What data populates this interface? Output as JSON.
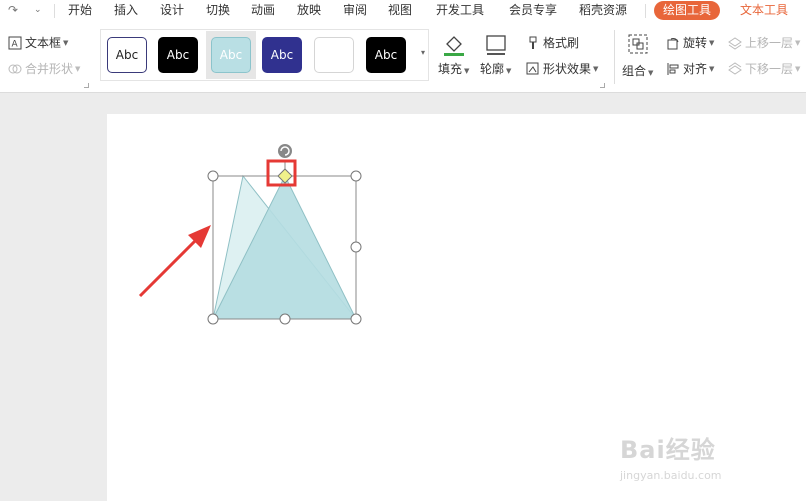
{
  "quick_access": {
    "redo_icon": "redo-icon",
    "more_icon": "chevron-down-icon"
  },
  "menu": {
    "tabs": [
      "开始",
      "插入",
      "设计",
      "切换",
      "动画",
      "放映",
      "审阅",
      "视图",
      "开发工具",
      "会员专享",
      "稻壳资源"
    ],
    "drawing_tools": "绘图工具",
    "text_tools": "文本工具"
  },
  "ribbon": {
    "textbox": "文本框",
    "merge_shapes": "合并形状",
    "style_gallery": [
      {
        "label": "Abc",
        "bg": "#ffffff",
        "fg": "#222222",
        "border": "#3a3a7a"
      },
      {
        "label": "Abc",
        "bg": "#000000",
        "fg": "#ffffff",
        "border": "#000000"
      },
      {
        "label": "Abc",
        "bg": "#b9dfe4",
        "fg": "#ffffff",
        "border": "#8cc4cc"
      },
      {
        "label": "Abc",
        "bg": "#30318f",
        "fg": "#ffffff",
        "border": "#30318f"
      },
      {
        "label": "",
        "bg": "#ffffff",
        "fg": "#222222",
        "border": "#d5d5d5"
      },
      {
        "label": "Abc",
        "bg": "#000000",
        "fg": "#ffffff",
        "border": "#000000"
      }
    ],
    "fill": "填充",
    "outline": "轮廓",
    "format_painter": "格式刷",
    "shape_effects": "形状效果",
    "group": "组合",
    "rotate": "旋转",
    "align": "对齐",
    "bring_forward": "上移一层",
    "send_backward": "下移一层"
  },
  "shape": {
    "fill": "#b5dde1",
    "ghost_fill": "#d8eef0",
    "stroke": "#8fc0c5"
  },
  "annotation": {
    "arrow_color": "#e53935",
    "highlight_color": "#e53935"
  },
  "watermark": {
    "main": "Bai经验",
    "sub": "jingyan.baidu.com"
  }
}
